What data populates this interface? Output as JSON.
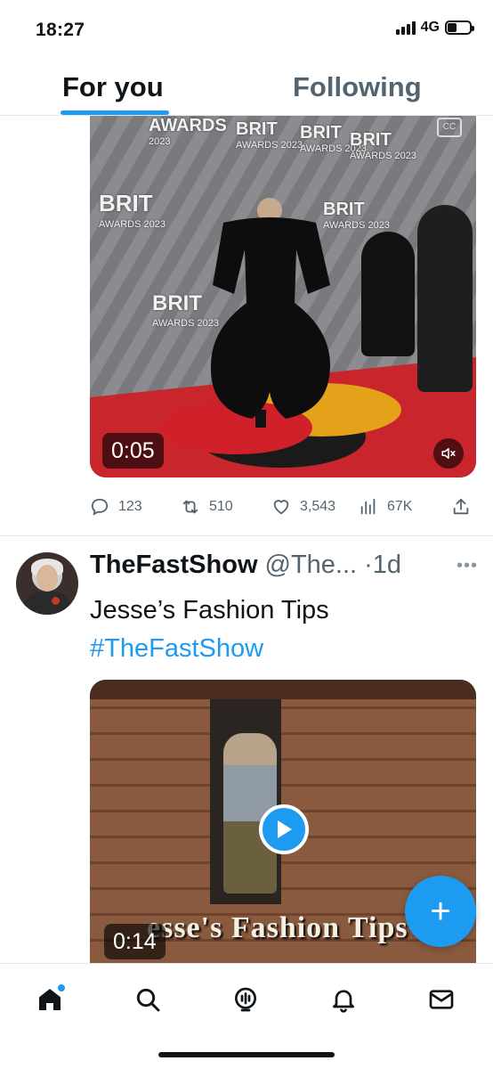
{
  "status_bar": {
    "time": "18:27",
    "network": "4G"
  },
  "tabs": [
    {
      "label": "For you",
      "active": true
    },
    {
      "label": "Following",
      "active": false
    }
  ],
  "accent_color": "#1d9bf0",
  "tweet1": {
    "media": {
      "duration": "0:05",
      "muted": true,
      "signage": [
        "BRIT AWARDS 2023"
      ]
    },
    "stats": {
      "replies": "123",
      "retweets": "510",
      "likes": "3,543",
      "views": "67K"
    }
  },
  "tweet2": {
    "display_name": "TheFastShow",
    "handle": "@The...",
    "time": "·1d",
    "text": "Jesse’s Fashion Tips",
    "hashtag": "#TheFastShow",
    "media": {
      "duration": "0:14",
      "caption": "esse's Fashion Tips"
    }
  },
  "fab": {
    "icon": "plus-icon",
    "label": "+"
  },
  "bottom_nav": [
    {
      "name": "home",
      "icon": "home-icon",
      "active": true,
      "has_badge": true
    },
    {
      "name": "search",
      "icon": "search-icon"
    },
    {
      "name": "spaces",
      "icon": "spaces-icon"
    },
    {
      "name": "notifications",
      "icon": "bell-icon"
    },
    {
      "name": "messages",
      "icon": "mail-icon"
    }
  ]
}
